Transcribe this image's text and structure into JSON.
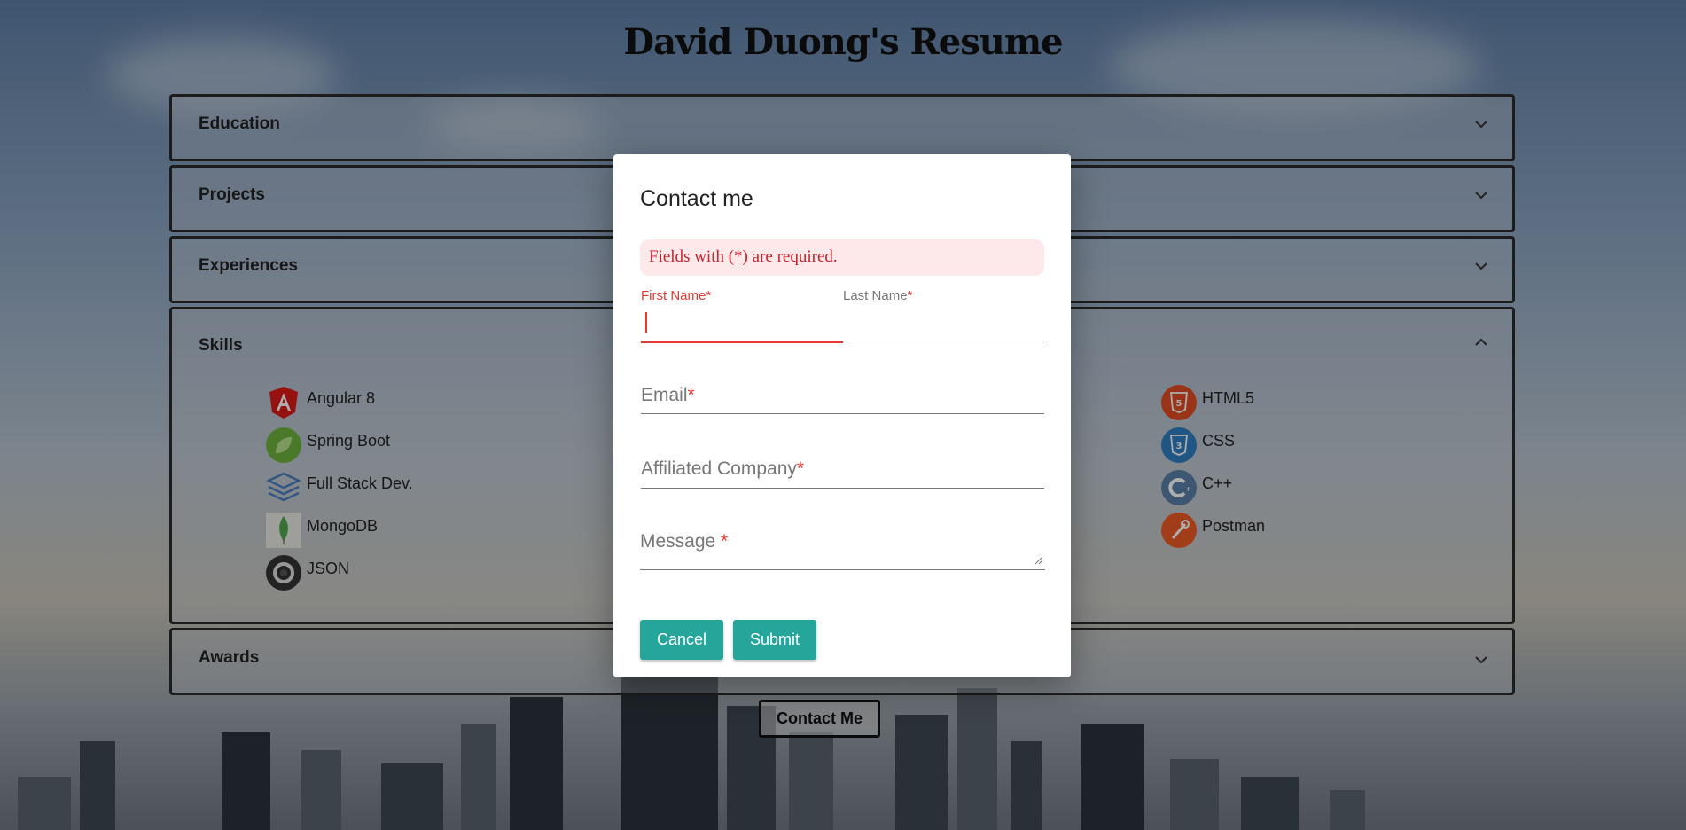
{
  "page": {
    "title": "David Duong's Resume",
    "contact_button": "Contact Me"
  },
  "sections": {
    "education": {
      "label": "Education",
      "icon": "chevron-down-icon"
    },
    "projects": {
      "label": "Projects",
      "icon": "chevron-down-icon"
    },
    "experiences": {
      "label": "Experiences",
      "icon": "chevron-down-icon"
    },
    "skills": {
      "label": "Skills",
      "icon": "chevron-up-icon"
    },
    "awards": {
      "label": "Awards",
      "icon": "chevron-down-icon"
    }
  },
  "skills": {
    "left": [
      {
        "label": "Angular 8",
        "icon": "angular-icon",
        "color": "#dd1b16"
      },
      {
        "label": "Spring Boot",
        "icon": "spring-boot-icon",
        "color": "#6db33f"
      },
      {
        "label": "Full Stack Dev.",
        "icon": "layers-icon",
        "color": "#4a7fc1"
      },
      {
        "label": "MongoDB",
        "icon": "mongodb-icon",
        "color": "#4fa94d"
      },
      {
        "label": "JSON",
        "icon": "json-icon",
        "color": "#333333"
      }
    ],
    "right": [
      {
        "label": "HTML5",
        "icon": "html5-icon",
        "color": "#e44d26"
      },
      {
        "label": "CSS",
        "icon": "css3-icon",
        "color": "#2f7fc1"
      },
      {
        "label": "C++",
        "icon": "cpp-icon",
        "color": "#5b7fa8"
      },
      {
        "label": "Postman",
        "icon": "postman-icon",
        "color": "#ef5b25"
      }
    ]
  },
  "modal": {
    "title": "Contact me",
    "alert": "Fields with (*) are required.",
    "first_name": "First Name",
    "last_name": "Last Name",
    "email": "Email",
    "company": "Affiliated Company",
    "message": "Message",
    "required_mark": "*",
    "message_required_mark": " *",
    "cancel": "Cancel",
    "submit": "Submit",
    "accent": "#26a69a",
    "error_color": "#e53935"
  }
}
